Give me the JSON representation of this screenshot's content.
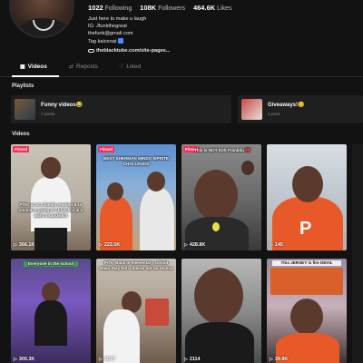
{
  "profile": {
    "stats": [
      {
        "value": "1022",
        "label": "Following"
      },
      {
        "value": "108K",
        "label": "Followers"
      },
      {
        "value": "464.6K",
        "label": "Likes"
      }
    ],
    "bio_lines": [
      "Just here to make u laugh",
      "IG: Jfunkthegreat",
      "thefunk@gmail.com",
      "Tag kaicenat"
    ],
    "link": "theblacktube.com/site-pages..."
  },
  "tabs": [
    {
      "label": "Videos",
      "icon": "grid-icon",
      "active": true
    },
    {
      "label": "Reposts",
      "icon": "repost-icon",
      "active": false
    },
    {
      "label": "Liked",
      "icon": "heart-outline-icon",
      "active": false
    }
  ],
  "sections": {
    "playlists": "Playlists",
    "videos": "Videos"
  },
  "playlists": [
    {
      "title": "Funny videos😂",
      "count": "7 posts"
    },
    {
      "title": "Giveaways!😊",
      "count": "1 post"
    }
  ],
  "videos": [
    {
      "badge": "Pinned",
      "caption": "POV: ur at a family reunion & ur cousin is going to chick-fil-a & u want a sandwich",
      "views": "366.1K"
    },
    {
      "badge": "Pinned",
      "caption": "BEST SHERMAN MINDS SIPRITE CHALLENGE",
      "views": "223.5K"
    },
    {
      "badge": "Pinned",
      "caption": "This is NOT Kirk Franklin 💔",
      "views": "428.8K"
    },
    {
      "badge": "",
      "caption": "",
      "views": "145"
    },
    {
      "badge": "",
      "caption": "Everyone in the school",
      "views": "300.3K"
    },
    {
      "badge": "",
      "caption": "POV: Back in elementary school when they tell u theres not no recess",
      "views": "3077"
    },
    {
      "badge": "",
      "caption": "",
      "views": "2114"
    },
    {
      "badge": "",
      "caption": "This JERSEY is fire DEVIL",
      "views": "39.8K"
    }
  ]
}
